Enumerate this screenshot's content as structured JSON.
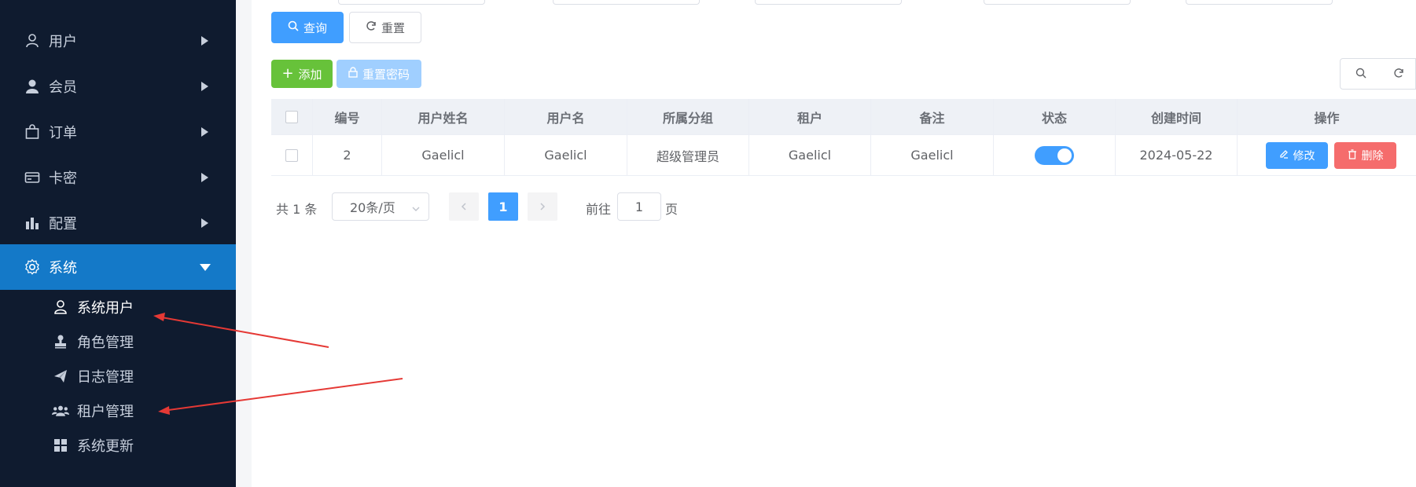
{
  "sidebar": {
    "menu": [
      {
        "label": "用户",
        "icon": "user-icon"
      },
      {
        "label": "会员",
        "icon": "member-icon"
      },
      {
        "label": "订单",
        "icon": "bag-icon"
      },
      {
        "label": "卡密",
        "icon": "card-icon"
      },
      {
        "label": "配置",
        "icon": "bar-chart-icon"
      },
      {
        "label": "系统",
        "icon": "gear-icon"
      }
    ],
    "submenu": [
      {
        "label": "系统用户",
        "icon": "user-icon"
      },
      {
        "label": "角色管理",
        "icon": "stamp-icon"
      },
      {
        "label": "日志管理",
        "icon": "paper-plane-icon"
      },
      {
        "label": "租户管理",
        "icon": "users-icon"
      },
      {
        "label": "系统更新",
        "icon": "grid-icon"
      }
    ]
  },
  "toolbar": {
    "query_label": "查询",
    "reset_label": "重置",
    "add_label": "添加",
    "reset_password_label": "重置密码"
  },
  "table": {
    "headers": [
      "编号",
      "用户姓名",
      "用户名",
      "所属分组",
      "租户",
      "备注",
      "状态",
      "创建时间",
      "操作"
    ],
    "rows": [
      {
        "id": "2",
        "full_name": "Gaelicl",
        "username": "Gaelicl",
        "group": "超级管理员",
        "tenant": "Gaelicl",
        "remark": "Gaelicl",
        "status": true,
        "created": "2024-05-22",
        "edit_label": "修改",
        "delete_label": "删除"
      }
    ]
  },
  "pagination": {
    "total_text": "共 1 条",
    "page_size": "20条/页",
    "current_page": "1",
    "goto_prefix": "前往",
    "goto_value": "1",
    "goto_suffix": "页"
  },
  "colors": {
    "sidebar_bg": "#0f1b2f",
    "sidebar_active": "#1479c8",
    "primary": "#409eff",
    "success": "#67c23a",
    "danger": "#f56c6c",
    "annotation_arrow": "#e53935"
  }
}
